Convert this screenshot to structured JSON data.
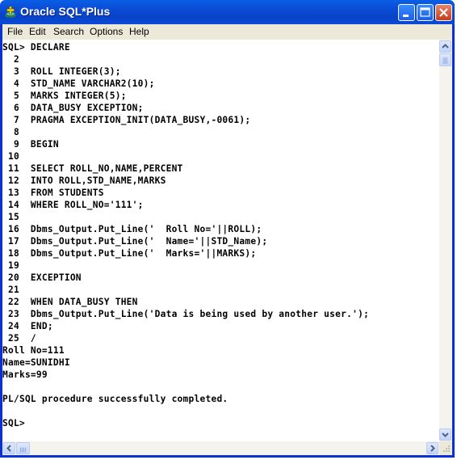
{
  "window": {
    "title": "Oracle SQL*Plus",
    "icon": "oracle-sqlplus-icon",
    "controls": [
      "minimize-icon",
      "maximize-icon",
      "close-icon"
    ]
  },
  "menubar": {
    "items": [
      {
        "label": "File"
      },
      {
        "label": "Edit"
      },
      {
        "label": "Search"
      },
      {
        "label": "Options"
      },
      {
        "label": "Help"
      }
    ]
  },
  "console": {
    "lines": [
      "SQL> DECLARE",
      "  2",
      "  3  ROLL INTEGER(3);",
      "  4  STD_NAME VARCHAR2(10);",
      "  5  MARKS INTEGER(5);",
      "  6  DATA_BUSY EXCEPTION;",
      "  7  PRAGMA EXCEPTION_INIT(DATA_BUSY,-0061);",
      "  8",
      "  9  BEGIN",
      " 10",
      " 11  SELECT ROLL_NO,NAME,PERCENT",
      " 12  INTO ROLL,STD_NAME,MARKS",
      " 13  FROM STUDENTS",
      " 14  WHERE ROLL_NO='111';",
      " 15",
      " 16  Dbms_Output.Put_Line('  Roll No='||ROLL);",
      " 17  Dbms_Output.Put_Line('  Name='||STD_Name);",
      " 18  Dbms_Output.Put_Line('  Marks='||MARKS);",
      " 19",
      " 20  EXCEPTION",
      " 21",
      " 22  WHEN DATA_BUSY THEN",
      " 23  Dbms_Output.Put_Line('Data is being used by another user.');",
      " 24  END;",
      " 25  /",
      "Roll No=111",
      "Name=SUNIDHI",
      "Marks=99",
      "",
      "PL/SQL procedure successfully completed.",
      "",
      "SQL> "
    ]
  },
  "scrollbars": {
    "vertical": {
      "up": "scroll-up-arrow-icon",
      "down": "scroll-down-arrow-icon"
    },
    "horizontal": {
      "left": "scroll-left-arrow-icon",
      "right": "scroll-right-arrow-icon"
    }
  }
}
